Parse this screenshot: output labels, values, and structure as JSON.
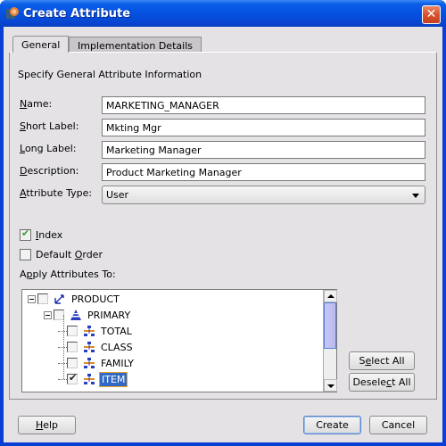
{
  "window": {
    "title": "Create Attribute",
    "close_label": "✕"
  },
  "tabs": [
    {
      "label": "General",
      "selected": true
    },
    {
      "label": "Implementation Details",
      "selected": false
    }
  ],
  "general": {
    "header": "Specify General Attribute Information",
    "fields": {
      "name": {
        "label_u": "N",
        "label_rest": "ame:",
        "value": "MARKETING_MANAGER"
      },
      "short_label": {
        "label_u": "S",
        "label_rest": "hort Label:",
        "value": "Mkting Mgr"
      },
      "long_label": {
        "label_u": "L",
        "label_rest": "ong Label:",
        "value": "Marketing Manager"
      },
      "description": {
        "label_u": "D",
        "label_rest": "escription:",
        "value": "Product Marketing Manager"
      },
      "attribute_type": {
        "label_u": "A",
        "label_rest": "ttribute Type:",
        "value": "User"
      }
    },
    "index": {
      "label_u": "I",
      "label_rest": "ndex",
      "checked": true
    },
    "default_order": {
      "label_pre": "Default ",
      "label_u": "O",
      "label_rest": "rder",
      "checked": false
    },
    "apply_label": {
      "pre": "A",
      "u": "p",
      "rest": "ply Attributes To:"
    },
    "tree": [
      {
        "label": "PRODUCT",
        "icon": "dimension-icon",
        "checked": false,
        "level": 0
      },
      {
        "label": "PRIMARY",
        "icon": "hierarchy-icon",
        "checked": false,
        "level": 1
      },
      {
        "label": "TOTAL",
        "icon": "level-icon",
        "checked": false,
        "level": 2
      },
      {
        "label": "CLASS",
        "icon": "level-icon",
        "checked": false,
        "level": 2
      },
      {
        "label": "FAMILY",
        "icon": "level-icon",
        "checked": false,
        "level": 2
      },
      {
        "label": "ITEM",
        "icon": "level-icon",
        "checked": true,
        "level": 2,
        "selected": true
      }
    ],
    "select_all": {
      "pre": "S",
      "u": "e",
      "rest": "lect All"
    },
    "deselect_all": {
      "pre": "Desele",
      "u": "c",
      "rest": "t All"
    }
  },
  "footer": {
    "help": {
      "u": "H",
      "rest": "elp"
    },
    "create": "Create",
    "cancel": "Cancel"
  }
}
